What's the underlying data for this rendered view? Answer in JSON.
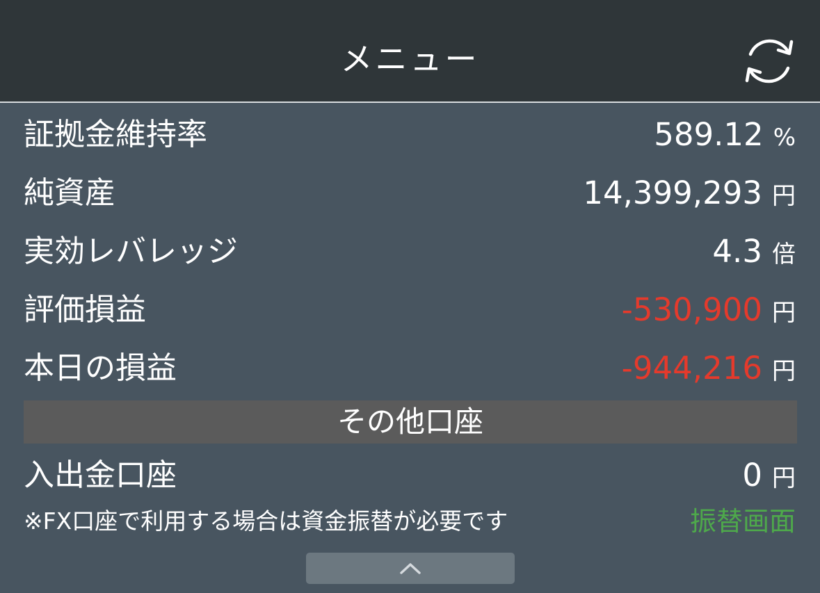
{
  "header": {
    "title": "メニュー",
    "refresh_icon": "refresh-icon"
  },
  "account": {
    "rows": [
      {
        "label": "証拠金維持率",
        "value": "589.12",
        "unit": "%",
        "negative": false
      },
      {
        "label": "純資産",
        "value": "14,399,293",
        "unit": "円",
        "negative": false
      },
      {
        "label": "実効レバレッジ",
        "value": "4.3",
        "unit": "倍",
        "negative": false
      },
      {
        "label": "評価損益",
        "value": "-530,900",
        "unit": "円",
        "negative": true
      },
      {
        "label": "本日の損益",
        "value": "-944,216",
        "unit": "円",
        "negative": true
      }
    ]
  },
  "other_accounts": {
    "section_title": "その他口座",
    "deposit_row": {
      "label": "入出金口座",
      "value": "0",
      "unit": "円"
    },
    "note": "※FX口座で利用する場合は資金振替が必要です",
    "transfer_link": "振替画面"
  },
  "footer": {
    "collapse_icon": "chevron-up-icon"
  },
  "colors": {
    "background": "#485560",
    "header": "#2f3639",
    "negative": "#e53a2c",
    "link": "#4ea94b",
    "section": "#5b5b5b"
  }
}
